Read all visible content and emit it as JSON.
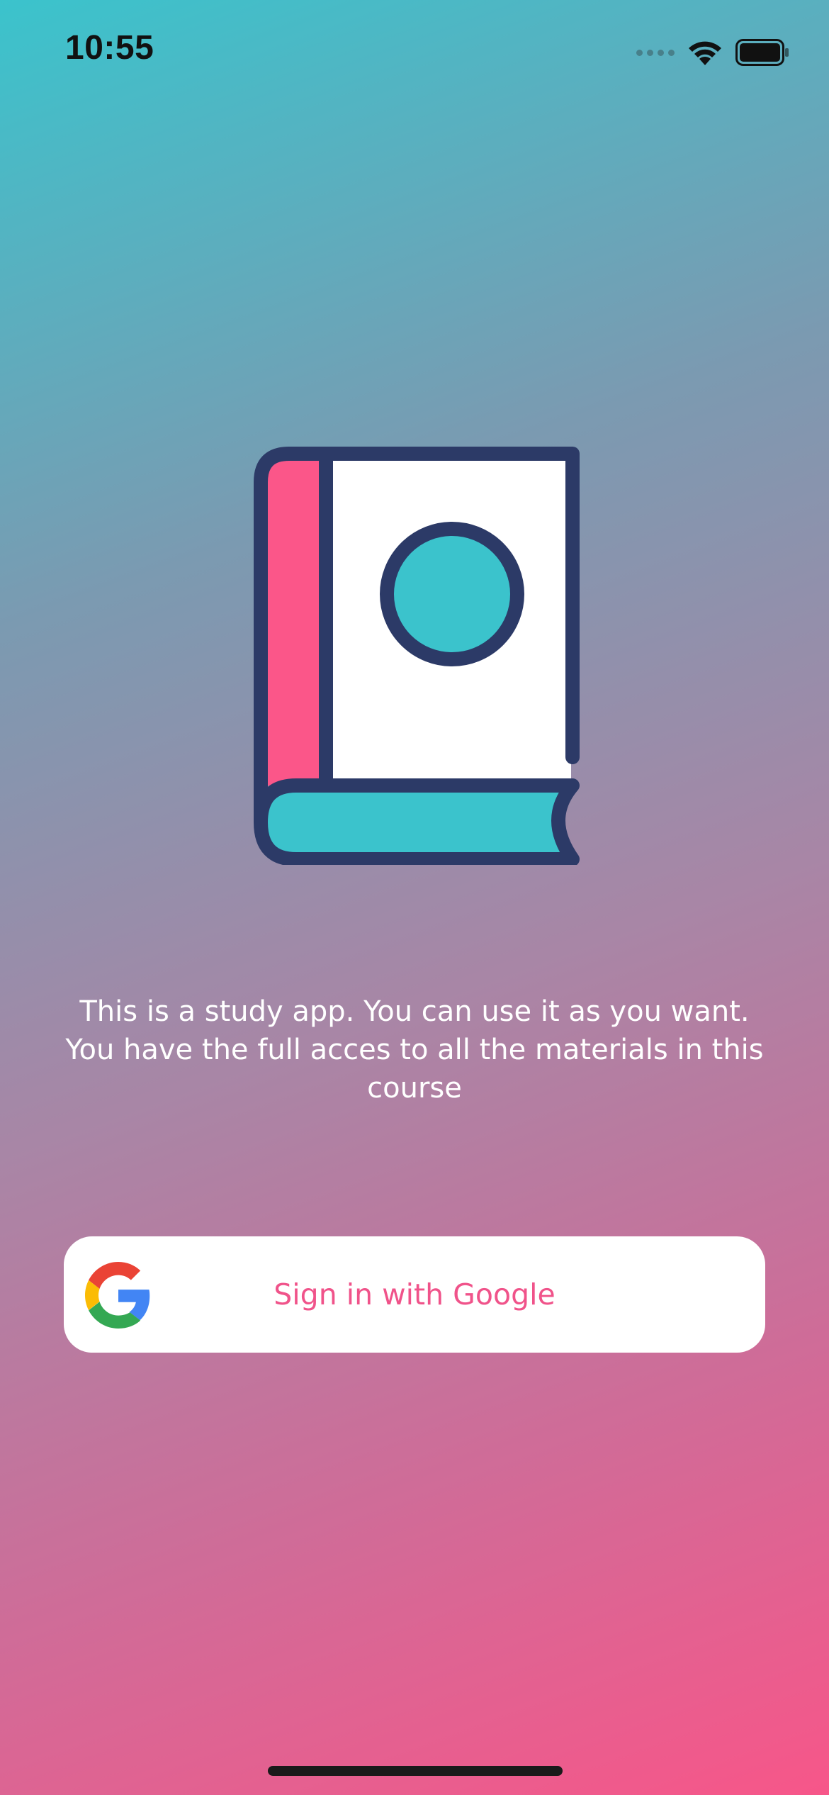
{
  "status_bar": {
    "time": "10:55",
    "icons": [
      "cellular-signal-icon",
      "wifi-icon",
      "battery-icon"
    ]
  },
  "hero": {
    "icon": "book-icon"
  },
  "description": "This is a study app. You can use it as you want. You have the full acces to all the materials in this course",
  "google_button": {
    "label": "Sign in with Google",
    "icon": "google-g-icon"
  },
  "colors": {
    "gradient_top": "#3bc3cc",
    "gradient_bottom": "#f75689",
    "accent_pink": "#f0538a",
    "book_navy": "#2c3a67",
    "book_teal": "#3bc3cc",
    "book_pink": "#fb5689"
  }
}
